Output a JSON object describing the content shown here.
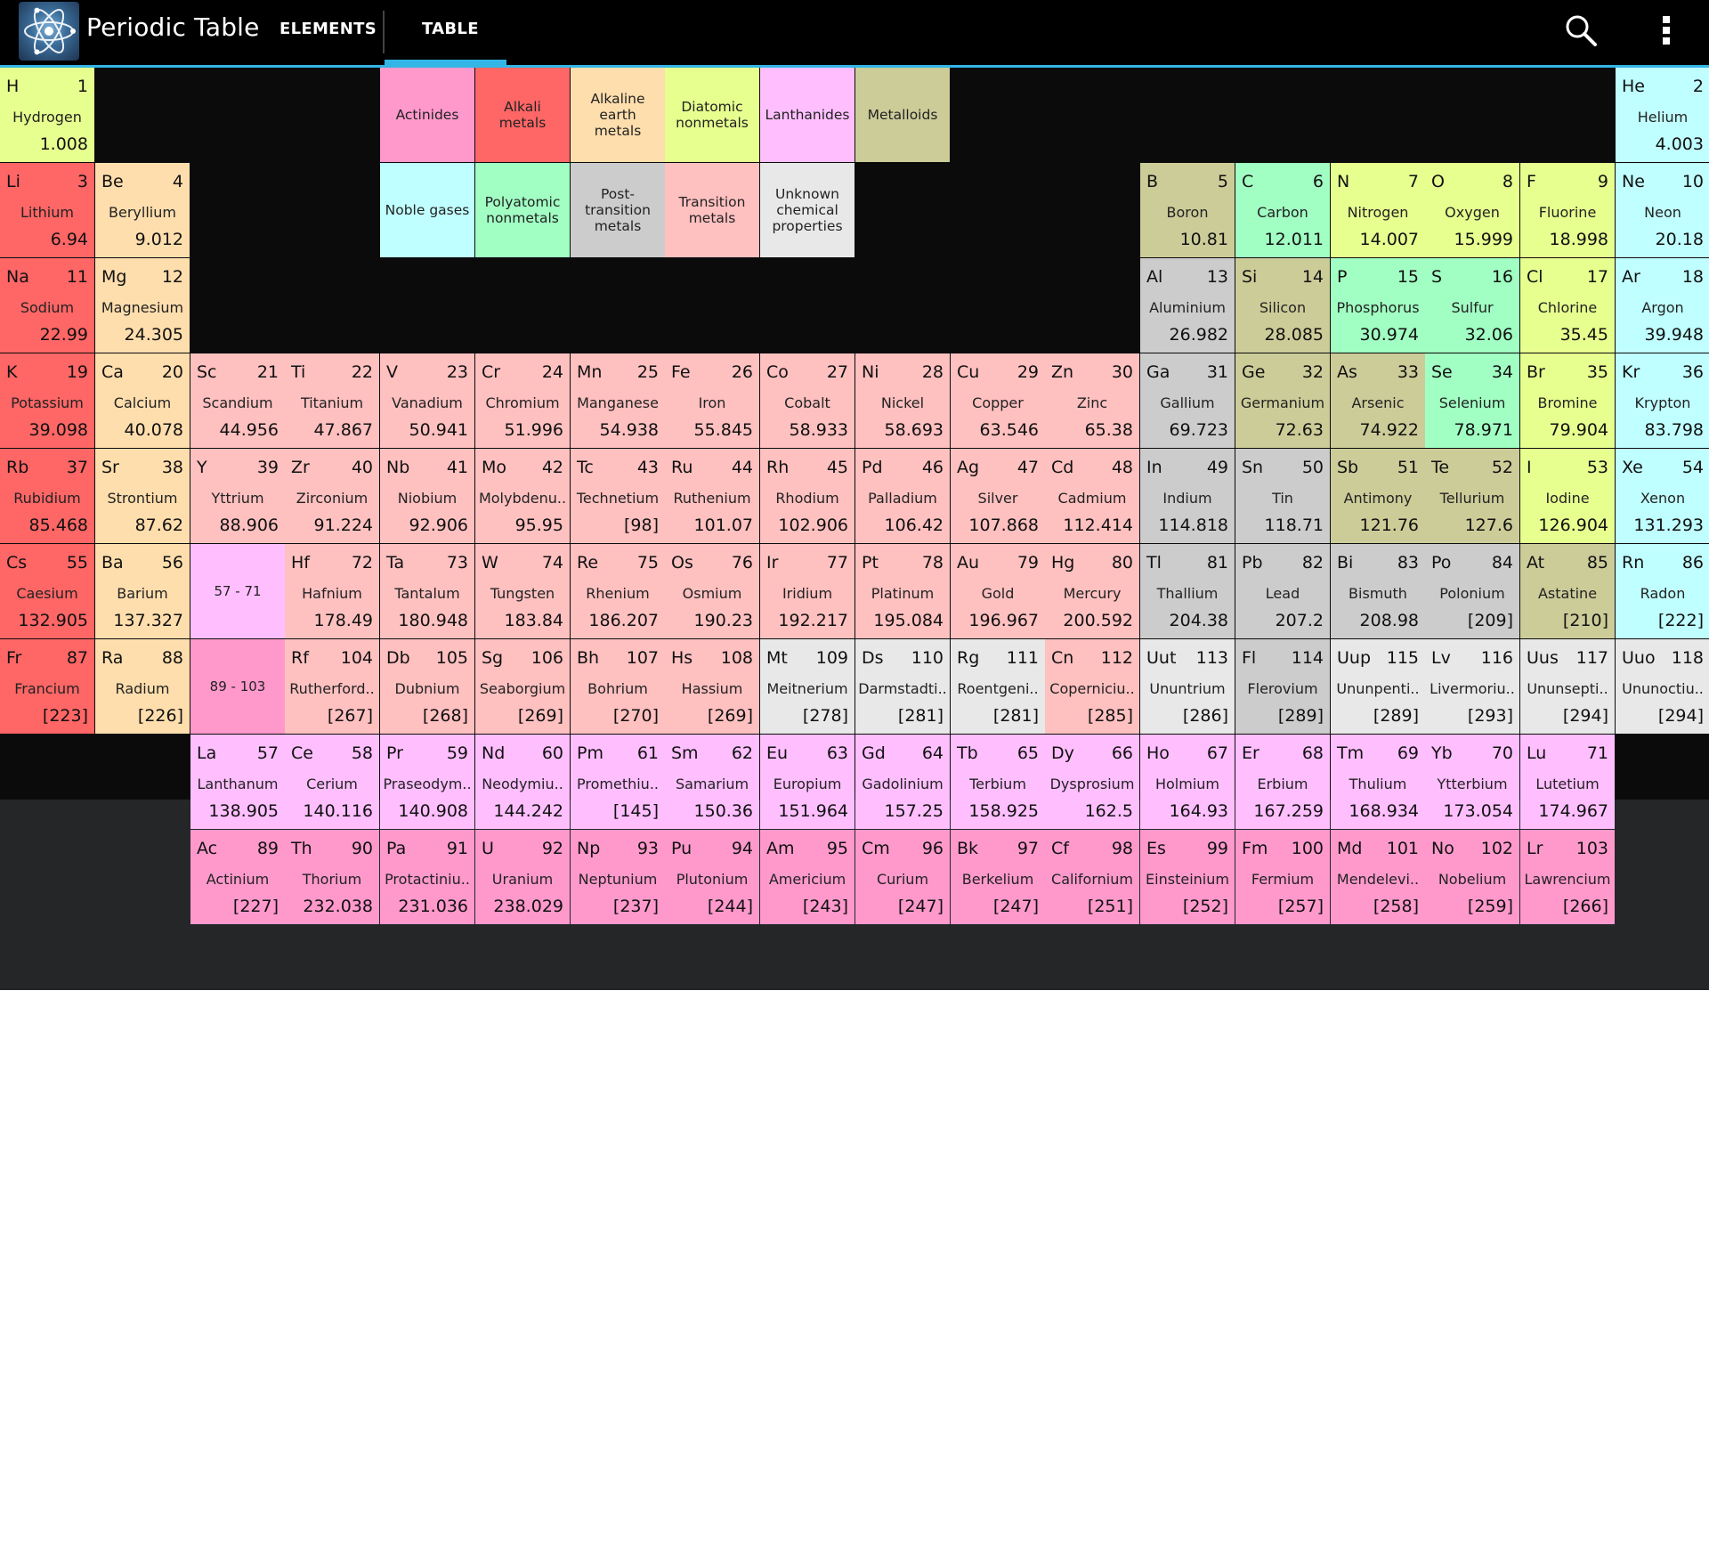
{
  "app": {
    "title": "Periodic Table",
    "icon": "atom-icon",
    "tabs": [
      {
        "label": "ELEMENTS",
        "selected": false
      },
      {
        "label": "TABLE",
        "selected": true
      }
    ],
    "actions": {
      "search_icon": "search-icon",
      "menu_icon": "overflow-menu-icon"
    },
    "accent_color": "#33b5e5"
  },
  "category_colors": {
    "alkali": "#ff6666",
    "alkaline": "#ffdead",
    "transition": "#ffc0c0",
    "post": "#cccccc",
    "metalloid": "#cccc99",
    "polyatomic": "#a1ffc3",
    "diatomic": "#e7ff8f",
    "noble": "#c0ffff",
    "lanthanide": "#ffbfff",
    "actinide": "#ff99cc",
    "unknown": "#e8e8e8"
  },
  "legend": [
    {
      "label": "Actinides",
      "cat": "actinide"
    },
    {
      "label": "Alkali metals",
      "cat": "alkali"
    },
    {
      "label": "Alkaline earth metals",
      "cat": "alkaline"
    },
    {
      "label": "Diatomic nonmetals",
      "cat": "diatomic"
    },
    {
      "label": "Lanthanides",
      "cat": "lanthanide"
    },
    {
      "label": "Metalloids",
      "cat": "metalloid"
    },
    {
      "label": "Noble gases",
      "cat": "noble"
    },
    {
      "label": "Polyatomic nonmetals",
      "cat": "polyatomic"
    },
    {
      "label": "Post-transition metals",
      "cat": "post"
    },
    {
      "label": "Transition metals",
      "cat": "transition"
    },
    {
      "label": "Unknown chemical properties",
      "cat": "unknown"
    }
  ],
  "placeholders": [
    {
      "label": "57 - 71",
      "cat": "lanthanide"
    },
    {
      "label": "89 - 103",
      "cat": "actinide"
    }
  ],
  "elements": [
    {
      "sym": "H",
      "num": "1",
      "name": "Hydrogen",
      "mass": "1.008",
      "cat": "diatomic"
    },
    {
      "sym": "He",
      "num": "2",
      "name": "Helium",
      "mass": "4.003",
      "cat": "noble"
    },
    {
      "sym": "Li",
      "num": "3",
      "name": "Lithium",
      "mass": "6.94",
      "cat": "alkali"
    },
    {
      "sym": "Be",
      "num": "4",
      "name": "Beryllium",
      "mass": "9.012",
      "cat": "alkaline"
    },
    {
      "sym": "B",
      "num": "5",
      "name": "Boron",
      "mass": "10.81",
      "cat": "metalloid"
    },
    {
      "sym": "C",
      "num": "6",
      "name": "Carbon",
      "mass": "12.011",
      "cat": "polyatomic"
    },
    {
      "sym": "N",
      "num": "7",
      "name": "Nitrogen",
      "mass": "14.007",
      "cat": "diatomic"
    },
    {
      "sym": "O",
      "num": "8",
      "name": "Oxygen",
      "mass": "15.999",
      "cat": "diatomic"
    },
    {
      "sym": "F",
      "num": "9",
      "name": "Fluorine",
      "mass": "18.998",
      "cat": "diatomic"
    },
    {
      "sym": "Ne",
      "num": "10",
      "name": "Neon",
      "mass": "20.18",
      "cat": "noble"
    },
    {
      "sym": "Na",
      "num": "11",
      "name": "Sodium",
      "mass": "22.99",
      "cat": "alkali"
    },
    {
      "sym": "Mg",
      "num": "12",
      "name": "Magnesium",
      "mass": "24.305",
      "cat": "alkaline"
    },
    {
      "sym": "Al",
      "num": "13",
      "name": "Aluminium",
      "mass": "26.982",
      "cat": "post"
    },
    {
      "sym": "Si",
      "num": "14",
      "name": "Silicon",
      "mass": "28.085",
      "cat": "metalloid"
    },
    {
      "sym": "P",
      "num": "15",
      "name": "Phosphorus",
      "mass": "30.974",
      "cat": "polyatomic"
    },
    {
      "sym": "S",
      "num": "16",
      "name": "Sulfur",
      "mass": "32.06",
      "cat": "polyatomic"
    },
    {
      "sym": "Cl",
      "num": "17",
      "name": "Chlorine",
      "mass": "35.45",
      "cat": "diatomic"
    },
    {
      "sym": "Ar",
      "num": "18",
      "name": "Argon",
      "mass": "39.948",
      "cat": "noble"
    },
    {
      "sym": "K",
      "num": "19",
      "name": "Potassium",
      "mass": "39.098",
      "cat": "alkali"
    },
    {
      "sym": "Ca",
      "num": "20",
      "name": "Calcium",
      "mass": "40.078",
      "cat": "alkaline"
    },
    {
      "sym": "Sc",
      "num": "21",
      "name": "Scandium",
      "mass": "44.956",
      "cat": "transition"
    },
    {
      "sym": "Ti",
      "num": "22",
      "name": "Titanium",
      "mass": "47.867",
      "cat": "transition"
    },
    {
      "sym": "V",
      "num": "23",
      "name": "Vanadium",
      "mass": "50.941",
      "cat": "transition"
    },
    {
      "sym": "Cr",
      "num": "24",
      "name": "Chromium",
      "mass": "51.996",
      "cat": "transition"
    },
    {
      "sym": "Mn",
      "num": "25",
      "name": "Manganese",
      "mass": "54.938",
      "cat": "transition"
    },
    {
      "sym": "Fe",
      "num": "26",
      "name": "Iron",
      "mass": "55.845",
      "cat": "transition"
    },
    {
      "sym": "Co",
      "num": "27",
      "name": "Cobalt",
      "mass": "58.933",
      "cat": "transition"
    },
    {
      "sym": "Ni",
      "num": "28",
      "name": "Nickel",
      "mass": "58.693",
      "cat": "transition"
    },
    {
      "sym": "Cu",
      "num": "29",
      "name": "Copper",
      "mass": "63.546",
      "cat": "transition"
    },
    {
      "sym": "Zn",
      "num": "30",
      "name": "Zinc",
      "mass": "65.38",
      "cat": "transition"
    },
    {
      "sym": "Ga",
      "num": "31",
      "name": "Gallium",
      "mass": "69.723",
      "cat": "post"
    },
    {
      "sym": "Ge",
      "num": "32",
      "name": "Germanium",
      "mass": "72.63",
      "cat": "metalloid"
    },
    {
      "sym": "As",
      "num": "33",
      "name": "Arsenic",
      "mass": "74.922",
      "cat": "metalloid"
    },
    {
      "sym": "Se",
      "num": "34",
      "name": "Selenium",
      "mass": "78.971",
      "cat": "polyatomic"
    },
    {
      "sym": "Br",
      "num": "35",
      "name": "Bromine",
      "mass": "79.904",
      "cat": "diatomic"
    },
    {
      "sym": "Kr",
      "num": "36",
      "name": "Krypton",
      "mass": "83.798",
      "cat": "noble"
    },
    {
      "sym": "Rb",
      "num": "37",
      "name": "Rubidium",
      "mass": "85.468",
      "cat": "alkali"
    },
    {
      "sym": "Sr",
      "num": "38",
      "name": "Strontium",
      "mass": "87.62",
      "cat": "alkaline"
    },
    {
      "sym": "Y",
      "num": "39",
      "name": "Yttrium",
      "mass": "88.906",
      "cat": "transition"
    },
    {
      "sym": "Zr",
      "num": "40",
      "name": "Zirconium",
      "mass": "91.224",
      "cat": "transition"
    },
    {
      "sym": "Nb",
      "num": "41",
      "name": "Niobium",
      "mass": "92.906",
      "cat": "transition"
    },
    {
      "sym": "Mo",
      "num": "42",
      "name": "Molybdenu..",
      "mass": "95.95",
      "cat": "transition"
    },
    {
      "sym": "Tc",
      "num": "43",
      "name": "Technetium",
      "mass": "[98]",
      "cat": "transition"
    },
    {
      "sym": "Ru",
      "num": "44",
      "name": "Ruthenium",
      "mass": "101.07",
      "cat": "transition"
    },
    {
      "sym": "Rh",
      "num": "45",
      "name": "Rhodium",
      "mass": "102.906",
      "cat": "transition"
    },
    {
      "sym": "Pd",
      "num": "46",
      "name": "Palladium",
      "mass": "106.42",
      "cat": "transition"
    },
    {
      "sym": "Ag",
      "num": "47",
      "name": "Silver",
      "mass": "107.868",
      "cat": "transition"
    },
    {
      "sym": "Cd",
      "num": "48",
      "name": "Cadmium",
      "mass": "112.414",
      "cat": "transition"
    },
    {
      "sym": "In",
      "num": "49",
      "name": "Indium",
      "mass": "114.818",
      "cat": "post"
    },
    {
      "sym": "Sn",
      "num": "50",
      "name": "Tin",
      "mass": "118.71",
      "cat": "post"
    },
    {
      "sym": "Sb",
      "num": "51",
      "name": "Antimony",
      "mass": "121.76",
      "cat": "metalloid"
    },
    {
      "sym": "Te",
      "num": "52",
      "name": "Tellurium",
      "mass": "127.6",
      "cat": "metalloid"
    },
    {
      "sym": "I",
      "num": "53",
      "name": "Iodine",
      "mass": "126.904",
      "cat": "diatomic"
    },
    {
      "sym": "Xe",
      "num": "54",
      "name": "Xenon",
      "mass": "131.293",
      "cat": "noble"
    },
    {
      "sym": "Cs",
      "num": "55",
      "name": "Caesium",
      "mass": "132.905",
      "cat": "alkali"
    },
    {
      "sym": "Ba",
      "num": "56",
      "name": "Barium",
      "mass": "137.327",
      "cat": "alkaline"
    },
    {
      "sym": "Hf",
      "num": "72",
      "name": "Hafnium",
      "mass": "178.49",
      "cat": "transition"
    },
    {
      "sym": "Ta",
      "num": "73",
      "name": "Tantalum",
      "mass": "180.948",
      "cat": "transition"
    },
    {
      "sym": "W",
      "num": "74",
      "name": "Tungsten",
      "mass": "183.84",
      "cat": "transition"
    },
    {
      "sym": "Re",
      "num": "75",
      "name": "Rhenium",
      "mass": "186.207",
      "cat": "transition"
    },
    {
      "sym": "Os",
      "num": "76",
      "name": "Osmium",
      "mass": "190.23",
      "cat": "transition"
    },
    {
      "sym": "Ir",
      "num": "77",
      "name": "Iridium",
      "mass": "192.217",
      "cat": "transition"
    },
    {
      "sym": "Pt",
      "num": "78",
      "name": "Platinum",
      "mass": "195.084",
      "cat": "transition"
    },
    {
      "sym": "Au",
      "num": "79",
      "name": "Gold",
      "mass": "196.967",
      "cat": "transition"
    },
    {
      "sym": "Hg",
      "num": "80",
      "name": "Mercury",
      "mass": "200.592",
      "cat": "transition"
    },
    {
      "sym": "Tl",
      "num": "81",
      "name": "Thallium",
      "mass": "204.38",
      "cat": "post"
    },
    {
      "sym": "Pb",
      "num": "82",
      "name": "Lead",
      "mass": "207.2",
      "cat": "post"
    },
    {
      "sym": "Bi",
      "num": "83",
      "name": "Bismuth",
      "mass": "208.98",
      "cat": "post"
    },
    {
      "sym": "Po",
      "num": "84",
      "name": "Polonium",
      "mass": "[209]",
      "cat": "post"
    },
    {
      "sym": "At",
      "num": "85",
      "name": "Astatine",
      "mass": "[210]",
      "cat": "metalloid"
    },
    {
      "sym": "Rn",
      "num": "86",
      "name": "Radon",
      "mass": "[222]",
      "cat": "noble"
    },
    {
      "sym": "Fr",
      "num": "87",
      "name": "Francium",
      "mass": "[223]",
      "cat": "alkali"
    },
    {
      "sym": "Ra",
      "num": "88",
      "name": "Radium",
      "mass": "[226]",
      "cat": "alkaline"
    },
    {
      "sym": "Rf",
      "num": "104",
      "name": "Rutherford..",
      "mass": "[267]",
      "cat": "transition"
    },
    {
      "sym": "Db",
      "num": "105",
      "name": "Dubnium",
      "mass": "[268]",
      "cat": "transition"
    },
    {
      "sym": "Sg",
      "num": "106",
      "name": "Seaborgium",
      "mass": "[269]",
      "cat": "transition"
    },
    {
      "sym": "Bh",
      "num": "107",
      "name": "Bohrium",
      "mass": "[270]",
      "cat": "transition"
    },
    {
      "sym": "Hs",
      "num": "108",
      "name": "Hassium",
      "mass": "[269]",
      "cat": "transition"
    },
    {
      "sym": "Mt",
      "num": "109",
      "name": "Meitnerium",
      "mass": "[278]",
      "cat": "unknown"
    },
    {
      "sym": "Ds",
      "num": "110",
      "name": "Darmstadti..",
      "mass": "[281]",
      "cat": "unknown"
    },
    {
      "sym": "Rg",
      "num": "111",
      "name": "Roentgeni..",
      "mass": "[281]",
      "cat": "unknown"
    },
    {
      "sym": "Cn",
      "num": "112",
      "name": "Coperniciu..",
      "mass": "[285]",
      "cat": "transition"
    },
    {
      "sym": "Uut",
      "num": "113",
      "name": "Ununtrium",
      "mass": "[286]",
      "cat": "unknown"
    },
    {
      "sym": "Fl",
      "num": "114",
      "name": "Flerovium",
      "mass": "[289]",
      "cat": "post"
    },
    {
      "sym": "Uup",
      "num": "115",
      "name": "Ununpenti..",
      "mass": "[289]",
      "cat": "unknown"
    },
    {
      "sym": "Lv",
      "num": "116",
      "name": "Livermoriu..",
      "mass": "[293]",
      "cat": "unknown"
    },
    {
      "sym": "Uus",
      "num": "117",
      "name": "Ununsepti..",
      "mass": "[294]",
      "cat": "unknown"
    },
    {
      "sym": "Uuo",
      "num": "118",
      "name": "Ununoctiu..",
      "mass": "[294]",
      "cat": "unknown"
    },
    {
      "sym": "La",
      "num": "57",
      "name": "Lanthanum",
      "mass": "138.905",
      "cat": "lanthanide"
    },
    {
      "sym": "Ce",
      "num": "58",
      "name": "Cerium",
      "mass": "140.116",
      "cat": "lanthanide"
    },
    {
      "sym": "Pr",
      "num": "59",
      "name": "Praseodym..",
      "mass": "140.908",
      "cat": "lanthanide"
    },
    {
      "sym": "Nd",
      "num": "60",
      "name": "Neodymiu..",
      "mass": "144.242",
      "cat": "lanthanide"
    },
    {
      "sym": "Pm",
      "num": "61",
      "name": "Promethiu..",
      "mass": "[145]",
      "cat": "lanthanide"
    },
    {
      "sym": "Sm",
      "num": "62",
      "name": "Samarium",
      "mass": "150.36",
      "cat": "lanthanide"
    },
    {
      "sym": "Eu",
      "num": "63",
      "name": "Europium",
      "mass": "151.964",
      "cat": "lanthanide"
    },
    {
      "sym": "Gd",
      "num": "64",
      "name": "Gadolinium",
      "mass": "157.25",
      "cat": "lanthanide"
    },
    {
      "sym": "Tb",
      "num": "65",
      "name": "Terbium",
      "mass": "158.925",
      "cat": "lanthanide"
    },
    {
      "sym": "Dy",
      "num": "66",
      "name": "Dysprosium",
      "mass": "162.5",
      "cat": "lanthanide"
    },
    {
      "sym": "Ho",
      "num": "67",
      "name": "Holmium",
      "mass": "164.93",
      "cat": "lanthanide"
    },
    {
      "sym": "Er",
      "num": "68",
      "name": "Erbium",
      "mass": "167.259",
      "cat": "lanthanide"
    },
    {
      "sym": "Tm",
      "num": "69",
      "name": "Thulium",
      "mass": "168.934",
      "cat": "lanthanide"
    },
    {
      "sym": "Yb",
      "num": "70",
      "name": "Ytterbium",
      "mass": "173.054",
      "cat": "lanthanide"
    },
    {
      "sym": "Lu",
      "num": "71",
      "name": "Lutetium",
      "mass": "174.967",
      "cat": "lanthanide"
    },
    {
      "sym": "Ac",
      "num": "89",
      "name": "Actinium",
      "mass": "[227]",
      "cat": "actinide"
    },
    {
      "sym": "Th",
      "num": "90",
      "name": "Thorium",
      "mass": "232.038",
      "cat": "actinide"
    },
    {
      "sym": "Pa",
      "num": "91",
      "name": "Protactiniu..",
      "mass": "231.036",
      "cat": "actinide"
    },
    {
      "sym": "U",
      "num": "92",
      "name": "Uranium",
      "mass": "238.029",
      "cat": "actinide"
    },
    {
      "sym": "Np",
      "num": "93",
      "name": "Neptunium",
      "mass": "[237]",
      "cat": "actinide"
    },
    {
      "sym": "Pu",
      "num": "94",
      "name": "Plutonium",
      "mass": "[244]",
      "cat": "actinide"
    },
    {
      "sym": "Am",
      "num": "95",
      "name": "Americium",
      "mass": "[243]",
      "cat": "actinide"
    },
    {
      "sym": "Cm",
      "num": "96",
      "name": "Curium",
      "mass": "[247]",
      "cat": "actinide"
    },
    {
      "sym": "Bk",
      "num": "97",
      "name": "Berkelium",
      "mass": "[247]",
      "cat": "actinide"
    },
    {
      "sym": "Cf",
      "num": "98",
      "name": "Californium",
      "mass": "[251]",
      "cat": "actinide"
    },
    {
      "sym": "Es",
      "num": "99",
      "name": "Einsteinium",
      "mass": "[252]",
      "cat": "actinide"
    },
    {
      "sym": "Fm",
      "num": "100",
      "name": "Fermium",
      "mass": "[257]",
      "cat": "actinide"
    },
    {
      "sym": "Md",
      "num": "101",
      "name": "Mendelevi..",
      "mass": "[258]",
      "cat": "actinide"
    },
    {
      "sym": "No",
      "num": "102",
      "name": "Nobelium",
      "mass": "[259]",
      "cat": "actinide"
    },
    {
      "sym": "Lr",
      "num": "103",
      "name": "Lawrencium",
      "mass": "[266]",
      "cat": "actinide"
    }
  ]
}
